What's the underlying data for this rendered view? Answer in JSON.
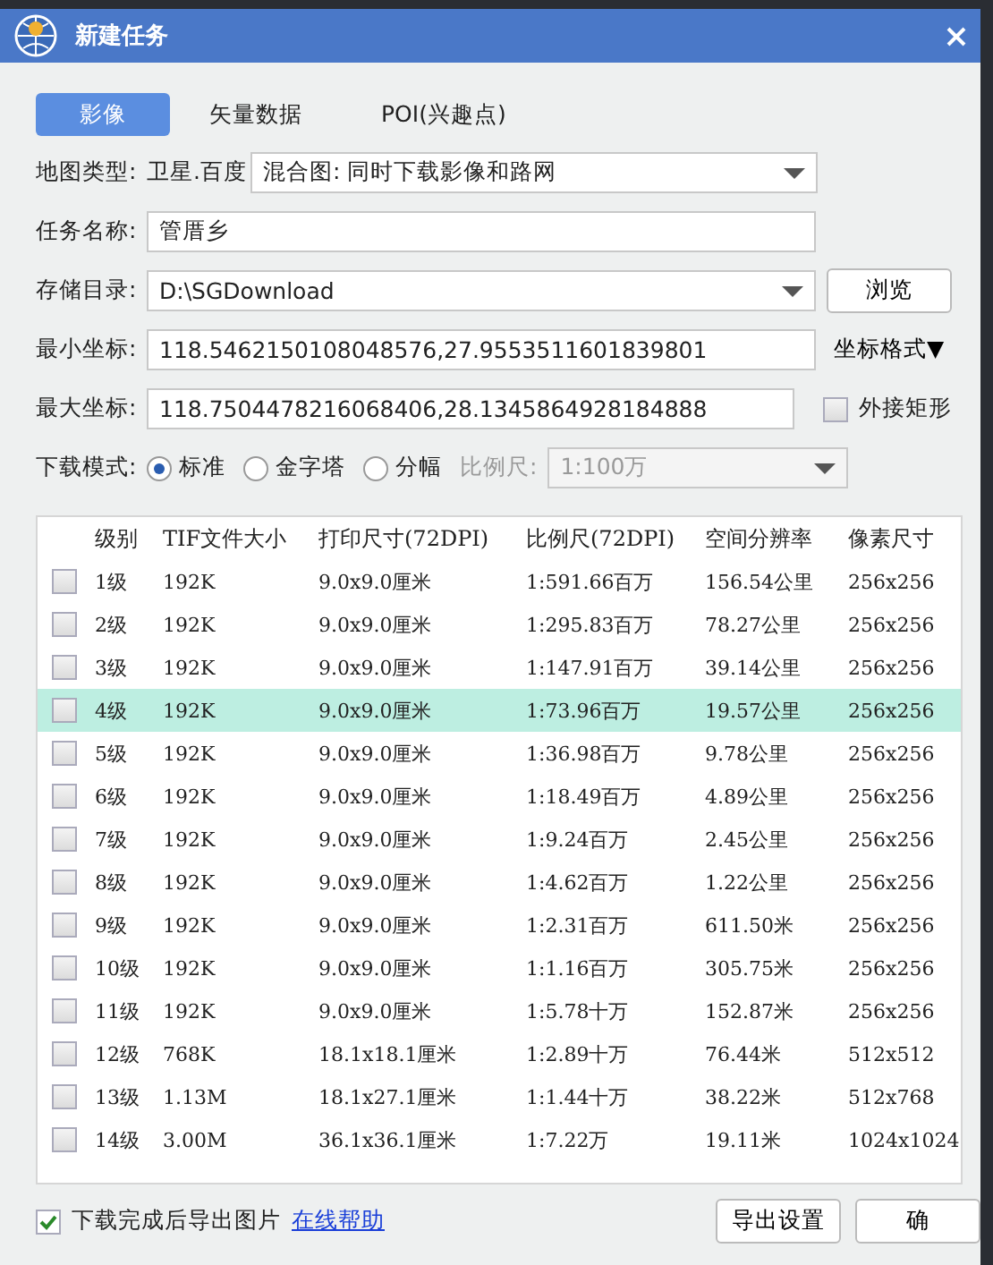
{
  "window": {
    "title": "新建任务"
  },
  "tabs": [
    {
      "label": "影像",
      "selected": true
    },
    {
      "label": "矢量数据",
      "selected": false
    },
    {
      "label": "POI(兴趣点)",
      "selected": false
    }
  ],
  "map_type": {
    "label": "地图类型:",
    "source": "卫星.百度",
    "value": "混合图: 同时下载影像和路网"
  },
  "task_name": {
    "label": "任务名称:",
    "value": "管厝乡"
  },
  "storage_dir": {
    "label": "存储目录:",
    "value": "D:\\SGDownload",
    "button": "浏览"
  },
  "min_coord": {
    "label": "最小坐标:",
    "value": "118.5462150108048576,27.9553511601839801",
    "button": "坐标格式▼"
  },
  "max_coord": {
    "label": "最大坐标:",
    "value": "118.7504478216068406,28.1345864928184888",
    "checkbox": {
      "label": "外接矩形",
      "checked": false
    }
  },
  "download_mode": {
    "label": "下载模式:",
    "options": [
      {
        "label": "标准",
        "selected": true
      },
      {
        "label": "金字塔",
        "selected": false
      },
      {
        "label": "分幅",
        "selected": false
      }
    ],
    "scale_label": "比例尺:",
    "scale_value": "1:100万",
    "scale_disabled": true
  },
  "table": {
    "columns": [
      "级别",
      "TIF文件大小",
      "打印尺寸(72DPI)",
      "比例尺(72DPI)",
      "空间分辨率",
      "像素尺寸"
    ],
    "rows": [
      {
        "checked": false,
        "selected": false,
        "cells": [
          "1级",
          "192K",
          "9.0x9.0厘米",
          "1:591.66百万",
          "156.54公里",
          "256x256"
        ]
      },
      {
        "checked": false,
        "selected": false,
        "cells": [
          "2级",
          "192K",
          "9.0x9.0厘米",
          "1:295.83百万",
          "78.27公里",
          "256x256"
        ]
      },
      {
        "checked": false,
        "selected": false,
        "cells": [
          "3级",
          "192K",
          "9.0x9.0厘米",
          "1:147.91百万",
          "39.14公里",
          "256x256"
        ]
      },
      {
        "checked": false,
        "selected": true,
        "cells": [
          "4级",
          "192K",
          "9.0x9.0厘米",
          "1:73.96百万",
          "19.57公里",
          "256x256"
        ]
      },
      {
        "checked": false,
        "selected": false,
        "cells": [
          "5级",
          "192K",
          "9.0x9.0厘米",
          "1:36.98百万",
          "9.78公里",
          "256x256"
        ]
      },
      {
        "checked": false,
        "selected": false,
        "cells": [
          "6级",
          "192K",
          "9.0x9.0厘米",
          "1:18.49百万",
          "4.89公里",
          "256x256"
        ]
      },
      {
        "checked": false,
        "selected": false,
        "cells": [
          "7级",
          "192K",
          "9.0x9.0厘米",
          "1:9.24百万",
          "2.45公里",
          "256x256"
        ]
      },
      {
        "checked": false,
        "selected": false,
        "cells": [
          "8级",
          "192K",
          "9.0x9.0厘米",
          "1:4.62百万",
          "1.22公里",
          "256x256"
        ]
      },
      {
        "checked": false,
        "selected": false,
        "cells": [
          "9级",
          "192K",
          "9.0x9.0厘米",
          "1:2.31百万",
          "611.50米",
          "256x256"
        ]
      },
      {
        "checked": false,
        "selected": false,
        "cells": [
          "10级",
          "192K",
          "9.0x9.0厘米",
          "1:1.16百万",
          "305.75米",
          "256x256"
        ]
      },
      {
        "checked": false,
        "selected": false,
        "cells": [
          "11级",
          "192K",
          "9.0x9.0厘米",
          "1:5.78十万",
          "152.87米",
          "256x256"
        ]
      },
      {
        "checked": false,
        "selected": false,
        "cells": [
          "12级",
          "768K",
          "18.1x18.1厘米",
          "1:2.89十万",
          "76.44米",
          "512x512"
        ]
      },
      {
        "checked": false,
        "selected": false,
        "cells": [
          "13级",
          "1.13M",
          "18.1x27.1厘米",
          "1:1.44十万",
          "38.22米",
          "512x768"
        ]
      },
      {
        "checked": false,
        "selected": false,
        "cells": [
          "14级",
          "3.00M",
          "36.1x36.1厘米",
          "1:7.22万",
          "19.11米",
          "1024x1024"
        ]
      }
    ]
  },
  "footer": {
    "export_checkbox": {
      "label": "下载完成后导出图片",
      "checked": true
    },
    "help_link": "在线帮助",
    "buttons": [
      "导出设置",
      "确"
    ]
  }
}
